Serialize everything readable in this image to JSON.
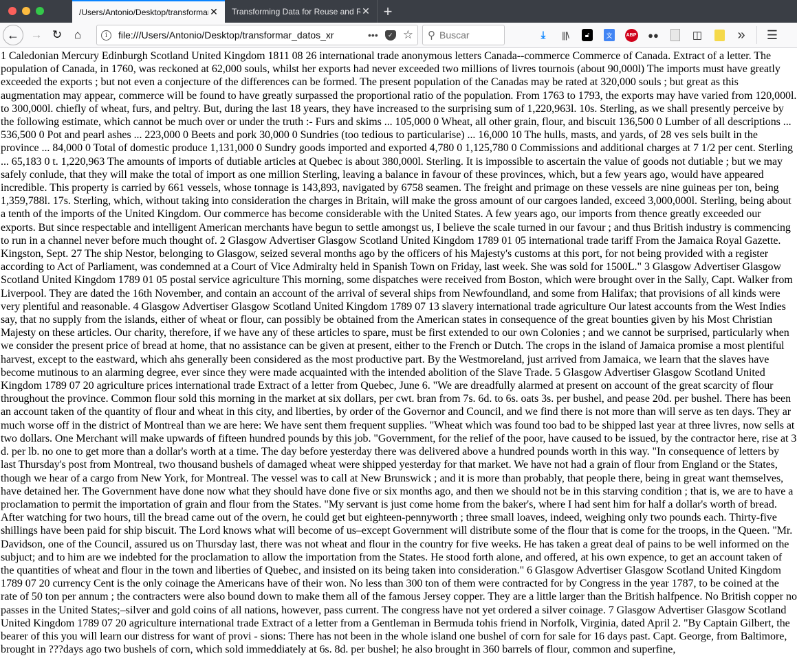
{
  "window": {
    "tabs": [
      {
        "title": "/Users/Antonio/Desktop/transformar",
        "active": true
      },
      {
        "title": "Transforming Data for Reuse and Re",
        "active": false
      }
    ],
    "new_tab_label": "+"
  },
  "navbar": {
    "back_icon": "←",
    "forward_icon": "→",
    "reload_icon": "↻",
    "home_icon": "⌂",
    "url": "file:///Users/Antonio/Desktop/transformar_datos_xr",
    "page_actions_icon": "•••",
    "bookmark_icon": "☆",
    "search_placeholder": "Buscar",
    "toolbar_icons": [
      "download-icon",
      "library-icon",
      "lock-extension-icon",
      "translate-icon",
      "adblock-plus-icon",
      "private-mask-icon",
      "document-icon",
      "sidebar-icon",
      "sticky-note-icon",
      "overflow-chevron-icon",
      "menu-icon"
    ],
    "abp_label": "ABP",
    "overflow_label": "»",
    "menu_label": "☰"
  },
  "document": {
    "text": "1 Caledonian Mercury Edinburgh Scotland United Kingdom 1811 08 26 international trade anonymous letters Canada--commerce Commerce of Canada. Extract of a letter. The population of Canada, in 1760, was reckoned at 62,000 souls, whilst her exports had never exceeded two millions of livres tournois (about 90,000l) The imports must have greatly exceeded the exports ; but not even a conjecture of the differences can be formed. The present population of the Canadas may be rated at 320,000 souls ; but great as this augmentation may appear, commerce will be found to have greatly surpassed the proportional ratio of the population. From 1763 to 1793, the exports may have varied from 120,000l. to 300,000l. chiefly of wheat, furs, and peltry. But, during the last 18 years, they have increased to the surprising sum of 1,220,963l. 10s. Sterling, as we shall presently perceive by the following estimate, which cannot be much over or under the truth :- Furs and skims ... 105,000 0 Wheat, all other grain, flour, and biscuit 136,500 0 Lumber of all descriptions ... 536,500 0 Pot and pearl ashes ... 223,000 0 Beets and pork 30,000 0 Sundries (too tedious to particularise) ... 16,000 10 The hulls, masts, and yards, of 28 ves sels built in the province ... 84,000 0 Total of domestic produce 1,131,000 0 Sundry goods imported and exported 4,780 0 1,125,780 0 Commissions and additional charges at 7 1/2 per cent. Sterling ... 65,183 0 t. 1,220,963 The amounts of imports of dutiable articles at Quebec is about 380,000l. Sterling. It is impossible to ascertain the value of goods not dutiable ; but we may safely conlude, that they will make the total of import as one million Sterling, leaving a balance in favour of these provinces, which, but a few years ago, would have appeared incredible. This property is carried by 661 vessels, whose tonnage is 143,893, navigated by 6758 seamen. The freight and primage on these vessels are nine guineas per ton, being 1,359,788l. 17s. Sterling, which, without taking into consideration the charges in Britain, will make the gross amount of our cargoes landed, exceed 3,000,000l. Sterling, being about a tenth of the imports of the United Kingdom. Our commerce has become considerable with the United States. A few years ago, our imports from thence greatly exceeded our exports. But since respectable and intelligent American merchants have begun to settle amongst us, I believe the scale turned in our favour ; and thus British industry is commencing to run in a channel never before much thought of. 2 Glasgow Advertiser Glasgow Scotland United Kingdom 1789 01 05 international trade tariff From the Jamaica Royal Gazette. Kingston, Sept. 27 The ship Nestor, belonging to Glasgow, seized several months ago by the officers of his Majesty's customs at this port, for not being provided with a register according to Act of Parliament, was condemned at a Court of Vice Admiralty held in Spanish Town on Friday, last week. She was sold for 1500L.\" 3 Glasgow Advertiser Glasgow Scotland United Kingdom 1789 01 05 postal service agriculture This morning, some dispatches were received from Boston, which were brought over in the Sally, Capt. Walker from Liverpool. They are dated the 16th November, and contain an account of the arrival of several ships from Newfoundland, and some from Halifax; that provisions of all kinds were very plentiful and reasonable. 4 Glasgow Advertiser Glasgow Scotland United Kingdom 1789 07 13 slavery international trade agriculture Our latest accounts from the West Indies say, that no supply from the islands, either of wheat or flour, can possibly be obtained from the American states in consequence of the great bounties given by his Most Christian Majesty on these articles. Our charity, therefore, if we have any of these articles to spare, must be first extended to our own Colonies ; and we cannot be surprised, particularly when we consider the present price of bread at home, that no assistance can be given at present, either to the French or Dutch. The crops in the island of Jamaica promise a most plentiful harvest, except to the eastward, which ahs generally been considered as the most productive part. By the Westmoreland, just arrived from Jamaica, we learn that the slaves have become mutinous to an alarming degree, ever since they were made acquainted with the intended abolition of the Slave Trade. 5 Glasgow Advertiser Glasgow Scotland United Kingdom 1789 07 20 agriculture prices international trade Extract of a letter from Quebec, June 6. \"We are dreadfully alarmed at present on account of the great scarcity of flour throughout the province. Common flour sold this morning in the market at six dollars, per cwt. bran from 7s. 6d. to 6s. oats 3s. per bushel, and pease 20d. per bushel. There has been an account taken of the quantity of flour and wheat in this city, and liberties, by order of the Governor and Council, and we find there is not more than will serve as ten days. They ar much worse off in the district of Montreal than we are here: We have sent them frequent supplies. \"Wheat which was found too bad to be shipped last year at three livres, now sells at two dollars. One Merchant will make upwards of fifteen hundred pounds by this job. \"Government, for the relief of the poor, have caused to be issued, by the contractor here, rise at 3 d. per lb. no one to get more than a dollar's worth at a time. The day before yesterday there was delivered above a hundred pounds worth in this way. \"In consequence of letters by last Thursday's post from Montreal, two thousand bushels of damaged wheat were shipped yesterday for that market. We have not had a grain of flour from England or the States, though we hear of a cargo from New York, for Montreal. The vessel was to call at New Brunswick ; and it is more than probably, that people there, being in great want themselves, have detained her. The Government have done now what they should have done five or six months ago, and then we should not be in this starving condition ; that is, we are to have a proclamation to permit the importation of grain and flour from the States. \"My servant is just come home from the baker's, where I had sent him for half a dollar's worth of bread. After watching for two hours, till the bread came out of the overn, he could get but eighteen-pennyworth ; three small loaves, indeed, weighing only two pounds each. Thirty-five shillings have been paid for ship biscuit. The Lord knows what will become of us–except Government will distribute some of the flour that is come for the troops, in the Queen. \"Mr. Davidson, one of the Council, assured us on Thursday last, there was not wheat and flour in the country for five weeks. He has taken a great deal of pains to be well informed on the subjuct; and to him are we indebted for the proclamation to allow the importation from the States. He stood forth alone, and offered, at his own expence, to get an account taken of the quantities of wheat and flour in the town and liberties of Quebec, and insisted on its being taken into consideration.\" 6 Glasgow Advertiser Glasgow Scotland United Kingdom 1789 07 20 currency Cent is the only coinage the Americans have of their won. No less than 300 ton of them were contracted for by Congress in the year 1787, to be coined at the rate of 50 ton per annum ; the contracters were also bound down to make them all of the famous Jersey copper. They are a little larger than the British halfpence. No British copper no passes in the United States;–silver and gold coins of all nations, however, pass current. The congress have not yet ordered a silver coinage. 7 Glasgow Advertiser Glasgow Scotland United Kingdom 1789 07 20 agriculture international trade Extract of a letter from a Gentleman in Bermuda tohis friend in Norfolk, Virginia, dated April 2. \"By Captain Gilbert, the bearer of this you will learn our distress for want of provi - sions: There has not been in the whole island one bushel of corn for sale for 16 days past. Capt. George, from Baltimore, brought in ???days ago two bushels of corn, which sold immeddiately at 6s. 8d. per bushel; he also brought in 360 barrels of flour, common and superfine,"
  }
}
